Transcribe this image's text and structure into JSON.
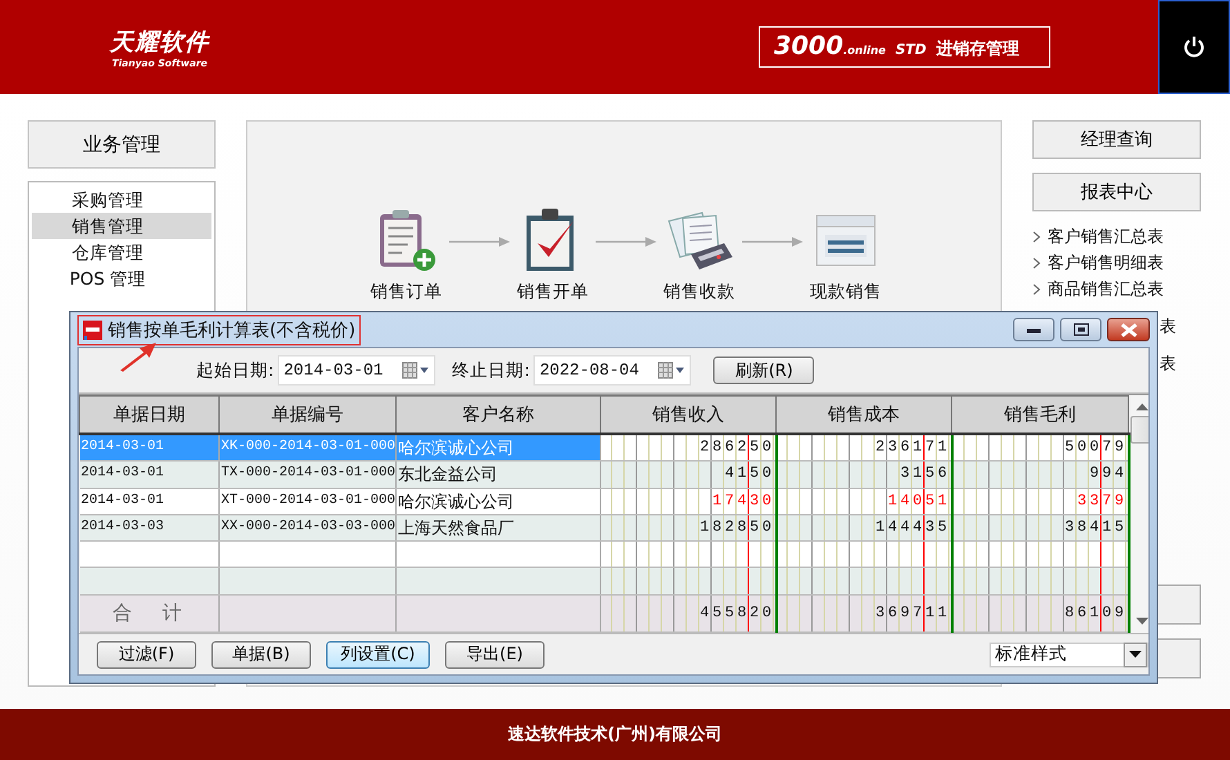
{
  "header": {
    "logo": {
      "name": "天耀软件",
      "subtitle": "Tianyao Software"
    },
    "product": {
      "number": "3000",
      "suffix": ".online",
      "edition": "STD",
      "name": "进销存管理"
    }
  },
  "left_panel": {
    "button": "业务管理",
    "menu": [
      {
        "label": "采购管理",
        "selected": false
      },
      {
        "label": "销售管理",
        "selected": true
      },
      {
        "label": "仓库管理",
        "selected": false
      },
      {
        "label": "POS 管理",
        "selected": false
      }
    ]
  },
  "workflow": [
    {
      "label": "销售订单",
      "kind": "order"
    },
    {
      "label": "销售开单",
      "kind": "invoice"
    },
    {
      "label": "销售收款",
      "kind": "receipt"
    },
    {
      "label": "现款销售",
      "kind": "cash"
    }
  ],
  "right_panel": {
    "buttons": [
      "经理查询",
      "报表中心"
    ],
    "links": [
      {
        "label": "客户销售汇总表",
        "kind": "full"
      },
      {
        "label": "客户销售明细表",
        "kind": "full"
      },
      {
        "label": "商品销售汇总表",
        "kind": "full"
      },
      {
        "label": "表",
        "kind": "covered"
      },
      {
        "label": "表",
        "kind": "covered"
      }
    ]
  },
  "dialog": {
    "title": "销售按单毛利计算表(不含税价)",
    "filters": [
      {
        "label": "起始日期:",
        "value": "2014-03-01"
      },
      {
        "label": "终止日期:",
        "value": "2022-08-04"
      }
    ],
    "refresh_button": "刷新(R)",
    "table": {
      "columns": [
        {
          "label": "单据日期",
          "kind": "text"
        },
        {
          "label": "单据编号",
          "kind": "text"
        },
        {
          "label": "客户名称",
          "kind": "text"
        },
        {
          "label": "销售收入",
          "kind": "money"
        },
        {
          "label": "销售成本",
          "kind": "money"
        },
        {
          "label": "销售毛利",
          "kind": "money"
        }
      ],
      "rows": [
        {
          "cells": [
            "2014-03-01",
            "XK-000-2014-03-01-000",
            "哈尔滨诚心公司",
            "286250",
            "236171",
            "50079"
          ],
          "selected": true,
          "negative": false
        },
        {
          "cells": [
            "2014-03-01",
            "TX-000-2014-03-01-000",
            "东北金益公司",
            "4150",
            "3156",
            "994"
          ],
          "selected": false,
          "negative": false
        },
        {
          "cells": [
            "2014-03-01",
            "XT-000-2014-03-01-000",
            "哈尔滨诚心公司",
            "17430",
            "14051",
            "3379"
          ],
          "selected": false,
          "negative": true
        },
        {
          "cells": [
            "2014-03-03",
            "XX-000-2014-03-03-000",
            "上海天然食品厂",
            "182850",
            "144435",
            "38415"
          ],
          "selected": false,
          "negative": false
        }
      ],
      "total": {
        "label": "合　计",
        "cells": [
          "455820",
          "369711",
          "86109"
        ]
      }
    },
    "buttons": [
      {
        "label": "过滤(F)",
        "focused": false
      },
      {
        "label": "单据(B)",
        "focused": false
      },
      {
        "label": "列设置(C)",
        "focused": true
      },
      {
        "label": "导出(E)",
        "focused": false
      }
    ],
    "style_select": "标准样式"
  },
  "footer": "速达软件技术(广州)有限公司"
}
